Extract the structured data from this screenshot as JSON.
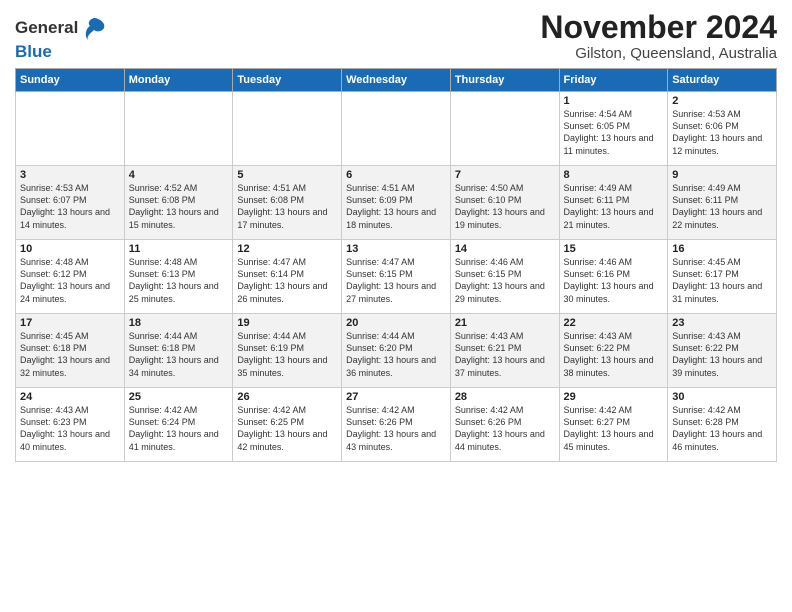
{
  "header": {
    "logo_line1": "General",
    "logo_line2": "Blue",
    "month": "November 2024",
    "location": "Gilston, Queensland, Australia"
  },
  "weekdays": [
    "Sunday",
    "Monday",
    "Tuesday",
    "Wednesday",
    "Thursday",
    "Friday",
    "Saturday"
  ],
  "weeks": [
    [
      {
        "day": "",
        "info": ""
      },
      {
        "day": "",
        "info": ""
      },
      {
        "day": "",
        "info": ""
      },
      {
        "day": "",
        "info": ""
      },
      {
        "day": "",
        "info": ""
      },
      {
        "day": "1",
        "info": "Sunrise: 4:54 AM\nSunset: 6:05 PM\nDaylight: 13 hours and 11 minutes."
      },
      {
        "day": "2",
        "info": "Sunrise: 4:53 AM\nSunset: 6:06 PM\nDaylight: 13 hours and 12 minutes."
      }
    ],
    [
      {
        "day": "3",
        "info": "Sunrise: 4:53 AM\nSunset: 6:07 PM\nDaylight: 13 hours and 14 minutes."
      },
      {
        "day": "4",
        "info": "Sunrise: 4:52 AM\nSunset: 6:08 PM\nDaylight: 13 hours and 15 minutes."
      },
      {
        "day": "5",
        "info": "Sunrise: 4:51 AM\nSunset: 6:08 PM\nDaylight: 13 hours and 17 minutes."
      },
      {
        "day": "6",
        "info": "Sunrise: 4:51 AM\nSunset: 6:09 PM\nDaylight: 13 hours and 18 minutes."
      },
      {
        "day": "7",
        "info": "Sunrise: 4:50 AM\nSunset: 6:10 PM\nDaylight: 13 hours and 19 minutes."
      },
      {
        "day": "8",
        "info": "Sunrise: 4:49 AM\nSunset: 6:11 PM\nDaylight: 13 hours and 21 minutes."
      },
      {
        "day": "9",
        "info": "Sunrise: 4:49 AM\nSunset: 6:11 PM\nDaylight: 13 hours and 22 minutes."
      }
    ],
    [
      {
        "day": "10",
        "info": "Sunrise: 4:48 AM\nSunset: 6:12 PM\nDaylight: 13 hours and 24 minutes."
      },
      {
        "day": "11",
        "info": "Sunrise: 4:48 AM\nSunset: 6:13 PM\nDaylight: 13 hours and 25 minutes."
      },
      {
        "day": "12",
        "info": "Sunrise: 4:47 AM\nSunset: 6:14 PM\nDaylight: 13 hours and 26 minutes."
      },
      {
        "day": "13",
        "info": "Sunrise: 4:47 AM\nSunset: 6:15 PM\nDaylight: 13 hours and 27 minutes."
      },
      {
        "day": "14",
        "info": "Sunrise: 4:46 AM\nSunset: 6:15 PM\nDaylight: 13 hours and 29 minutes."
      },
      {
        "day": "15",
        "info": "Sunrise: 4:46 AM\nSunset: 6:16 PM\nDaylight: 13 hours and 30 minutes."
      },
      {
        "day": "16",
        "info": "Sunrise: 4:45 AM\nSunset: 6:17 PM\nDaylight: 13 hours and 31 minutes."
      }
    ],
    [
      {
        "day": "17",
        "info": "Sunrise: 4:45 AM\nSunset: 6:18 PM\nDaylight: 13 hours and 32 minutes."
      },
      {
        "day": "18",
        "info": "Sunrise: 4:44 AM\nSunset: 6:18 PM\nDaylight: 13 hours and 34 minutes."
      },
      {
        "day": "19",
        "info": "Sunrise: 4:44 AM\nSunset: 6:19 PM\nDaylight: 13 hours and 35 minutes."
      },
      {
        "day": "20",
        "info": "Sunrise: 4:44 AM\nSunset: 6:20 PM\nDaylight: 13 hours and 36 minutes."
      },
      {
        "day": "21",
        "info": "Sunrise: 4:43 AM\nSunset: 6:21 PM\nDaylight: 13 hours and 37 minutes."
      },
      {
        "day": "22",
        "info": "Sunrise: 4:43 AM\nSunset: 6:22 PM\nDaylight: 13 hours and 38 minutes."
      },
      {
        "day": "23",
        "info": "Sunrise: 4:43 AM\nSunset: 6:22 PM\nDaylight: 13 hours and 39 minutes."
      }
    ],
    [
      {
        "day": "24",
        "info": "Sunrise: 4:43 AM\nSunset: 6:23 PM\nDaylight: 13 hours and 40 minutes."
      },
      {
        "day": "25",
        "info": "Sunrise: 4:42 AM\nSunset: 6:24 PM\nDaylight: 13 hours and 41 minutes."
      },
      {
        "day": "26",
        "info": "Sunrise: 4:42 AM\nSunset: 6:25 PM\nDaylight: 13 hours and 42 minutes."
      },
      {
        "day": "27",
        "info": "Sunrise: 4:42 AM\nSunset: 6:26 PM\nDaylight: 13 hours and 43 minutes."
      },
      {
        "day": "28",
        "info": "Sunrise: 4:42 AM\nSunset: 6:26 PM\nDaylight: 13 hours and 44 minutes."
      },
      {
        "day": "29",
        "info": "Sunrise: 4:42 AM\nSunset: 6:27 PM\nDaylight: 13 hours and 45 minutes."
      },
      {
        "day": "30",
        "info": "Sunrise: 4:42 AM\nSunset: 6:28 PM\nDaylight: 13 hours and 46 minutes."
      }
    ]
  ]
}
